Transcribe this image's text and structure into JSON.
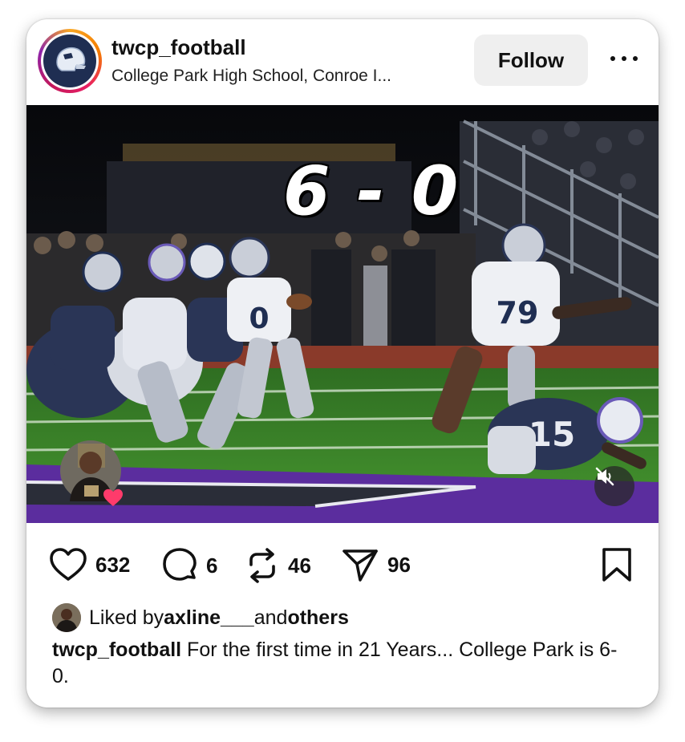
{
  "post": {
    "username": "twcp_football",
    "location": "College Park High School, Conroe I...",
    "follow_label": "Follow",
    "media": {
      "overlay_text": "6 - 0",
      "jersey_numbers": [
        "0",
        "79",
        "15"
      ]
    },
    "actions": {
      "likes_count": "632",
      "comments_count": "6",
      "reposts_count": "46",
      "shares_count": "96"
    },
    "liked_by": {
      "prefix": "Liked by ",
      "user": "axline___",
      "connector": " and ",
      "others": "others"
    },
    "caption": {
      "author": "twcp_football",
      "text": " For the first time in 21 Years... College Park is 6-0."
    }
  },
  "colors": {
    "accent_purple": "#5b2d9e",
    "field_green": "#3f8a2e",
    "team_navy": "#1f2e52",
    "like_heart_pink": "#ff3b6b"
  }
}
